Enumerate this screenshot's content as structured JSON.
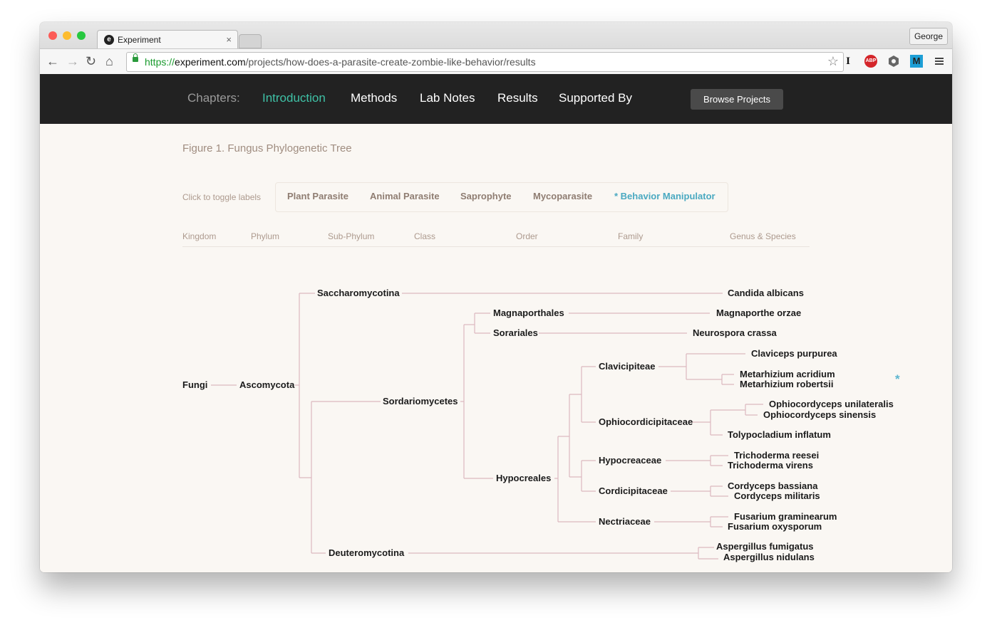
{
  "browser": {
    "tab_title": "Experiment",
    "tab_close": "×",
    "profile": "George",
    "url_scheme": "https://",
    "url_host": "experiment.com",
    "url_path": "/projects/how-does-a-parasite-create-zombie-like-behavior/results",
    "toolbar_icons": [
      "back-arrow-icon",
      "forward-arrow-icon",
      "reload-icon",
      "home-icon",
      "lock-icon",
      "star-icon",
      "instapaper-icon",
      "adblock-icon",
      "extension-icon",
      "m-extension-icon",
      "menu-icon"
    ],
    "ext_i": "I",
    "ext_abp": "ABP",
    "ext_m": "M",
    "accent_green": "#1a9a2e"
  },
  "site_nav": {
    "chapters_label": "Chapters:",
    "links": [
      "Introduction",
      "Methods",
      "Lab Notes",
      "Results",
      "Supported By"
    ],
    "active_link": "Introduction",
    "browse_button": "Browse Projects",
    "active_color": "#3fc1a6",
    "bar_color": "#222222"
  },
  "figure": {
    "title": "Figure 1. Fungus Phylogenetic Tree",
    "toggle_hint": "Click to toggle labels",
    "toggles": [
      "Plant Parasite",
      "Animal Parasite",
      "Saprophyte",
      "Mycoparasite",
      "* Behavior Manipulator"
    ],
    "active_toggle": "* Behavior Manipulator",
    "ranks": [
      "Kingdom",
      "Phylum",
      "Sub-Phylum",
      "Class",
      "Order",
      "Family",
      "Genus & Species"
    ],
    "behavior_color": "#4aa9c1"
  },
  "tree": {
    "kingdom": "Fungi",
    "phylum": "Ascomycota",
    "subphyla": [
      "Saccharomycotina",
      "Deuteromycotina"
    ],
    "class": "Sordariomycetes",
    "orders": [
      "Magnaporthales",
      "Sorariales",
      "Hypocreales"
    ],
    "families": [
      "Clavicipiteae",
      "Ophiocordicipitaceae",
      "Hypocreaceae",
      "Cordicipitaceae",
      "Nectriaceae"
    ],
    "species": [
      "Candida albicans",
      "Magnaporthe orzae",
      "Neurospora crassa",
      "Claviceps purpurea",
      "Metarhizium acridium",
      "Metarhizium robertsii",
      "Ophiocordyceps unilateralis",
      "Ophiocordyceps sinensis",
      "Tolypocladium inflatum",
      "Trichoderma reesei",
      "Trichoderma virens",
      "Cordyceps bassiana",
      "Cordyceps militaris",
      "Fusarium graminearum",
      "Fusarium oxysporum",
      "Aspergillus fumigatus",
      "Aspergillus nidulans"
    ],
    "behavior_marker": "*",
    "branch_color": "#dcb8bf"
  }
}
